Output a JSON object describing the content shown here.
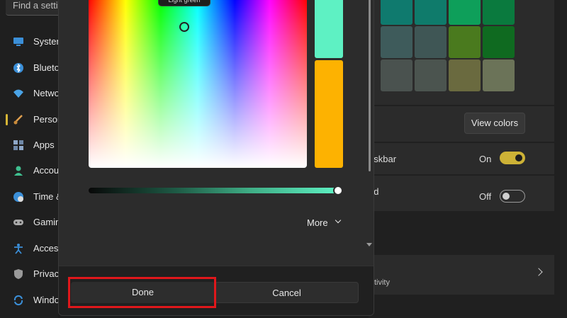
{
  "sidebar": {
    "search_placeholder": "Find a setting",
    "items": [
      {
        "label": "System",
        "icon": "monitor-icon",
        "color": "#3b8fd8"
      },
      {
        "label": "Bluetooth & devices",
        "icon": "bluetooth-icon",
        "color": "#3b8fd8"
      },
      {
        "label": "Network & internet",
        "icon": "wifi-icon",
        "color": "#4aa3e6"
      },
      {
        "label": "Personalization",
        "icon": "brush-icon",
        "color": "#e0a050",
        "active": true
      },
      {
        "label": "Apps",
        "icon": "apps-icon",
        "color": "#8fa8c8"
      },
      {
        "label": "Accounts",
        "icon": "person-icon",
        "color": "#3fbf8f"
      },
      {
        "label": "Time & language",
        "icon": "globe-clock-icon",
        "color": "#3b8fd8"
      },
      {
        "label": "Gaming",
        "icon": "controller-icon",
        "color": "#aaaaaa"
      },
      {
        "label": "Accessibility",
        "icon": "accessibility-icon",
        "color": "#3b8fd8"
      },
      {
        "label": "Privacy & security",
        "icon": "shield-icon",
        "color": "#9a9a9a"
      },
      {
        "label": "Windows Update",
        "icon": "update-icon",
        "color": "#3b8fd8"
      }
    ]
  },
  "dialog": {
    "tooltip": "Light green",
    "new_color": "#5ef1c3",
    "old_color": "#fdb201",
    "more_label": "More",
    "done_label": "Done",
    "cancel_label": "Cancel"
  },
  "right_panel": {
    "swatches": [
      [
        "#0f7a6e",
        "#0f7b6b",
        "#0e9f5a",
        "#0a7a3e"
      ],
      [
        "#3e5b5b",
        "#3f5655",
        "#4a7a1e",
        "#0f6a20"
      ],
      [
        "#4a524f",
        "#4b544f",
        "#6a6a3f",
        "#6b7358"
      ]
    ],
    "view_colors_label": "View colors",
    "taskbar_row_text": "askbar",
    "taskbar_toggle_state": "On",
    "second_row_text": "nd",
    "second_toggle_state": "Off",
    "bottom_row_text": "sitivity",
    "accent_color": "#cdb236"
  }
}
